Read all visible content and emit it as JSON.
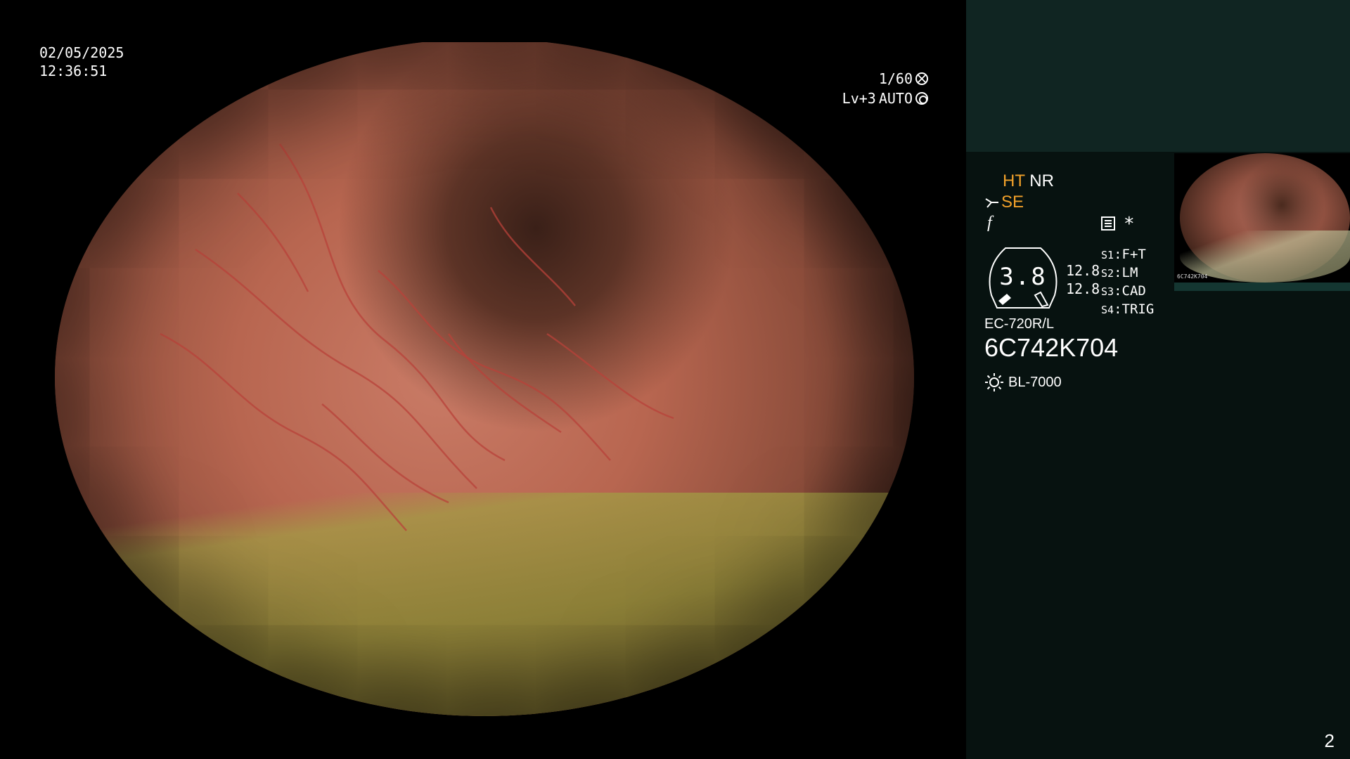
{
  "overlay": {
    "date": "02/05/2025",
    "time": "12:36:51",
    "shutter": "1/60",
    "level": "Lv+3",
    "iris_mode": "AUTO"
  },
  "panel": {
    "mode_ht": "HT",
    "mode_nr": "NR",
    "se_label": "SE",
    "f_symbol": "f",
    "star_symbol": "*",
    "gauge_value": "3.8",
    "gauge_num_1": "12.8",
    "gauge_num_2": "12.8",
    "switches": [
      {
        "key": "S1",
        "value": "F+T"
      },
      {
        "key": "S2",
        "value": "LM"
      },
      {
        "key": "S3",
        "value": "CAD"
      },
      {
        "key": "S4",
        "value": "TRIG"
      }
    ],
    "scope_model": "EC-720R/L",
    "scope_serial": "6C742K704",
    "light_source": "BL-7000",
    "thumbnail_label": "6C742K704",
    "page_number": "2"
  },
  "colors": {
    "panel_bg": "#071210",
    "panel_top_bg": "#102522",
    "accent_orange": "#f2a12a"
  },
  "icons": [
    "shutter-icon",
    "iris-auto-icon",
    "se-scissor-icon",
    "menu-icon",
    "star-icon",
    "gauge-icon",
    "sun-icon"
  ]
}
